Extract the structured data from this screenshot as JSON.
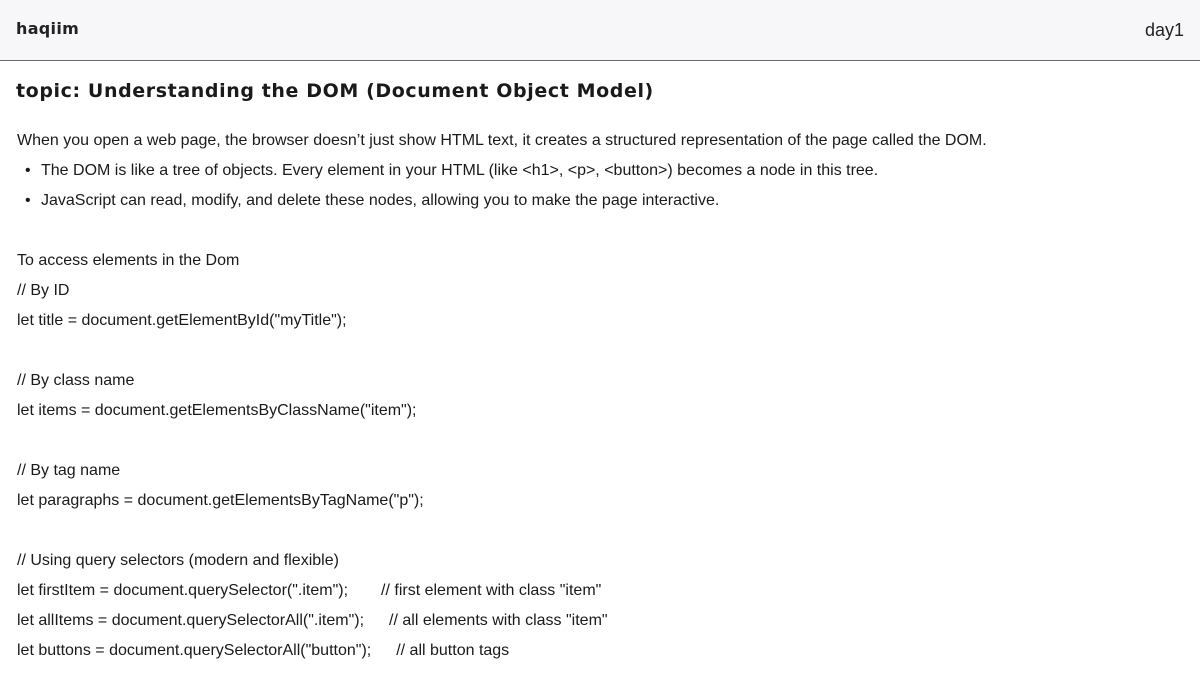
{
  "header": {
    "brand": "haqiim",
    "day": "day1"
  },
  "topic": "topic: Understanding the DOM (Document Object Model)",
  "intro": "When you open a web page, the browser doesn’t just show HTML text, it creates a structured representation of the page called the DOM.",
  "bullets": [
    "The DOM is like a tree of objects. Every element in your HTML (like <h1>, <p>, <button>) becomes a node in this tree.",
    "JavaScript can read, modify, and delete these nodes, allowing you to make the page interactive."
  ],
  "bullet_glyph": "•",
  "access_heading": "To access elements in the Dom",
  "sections": {
    "by_id": {
      "comment": "// By ID",
      "code": "let title = document.getElementById(\"myTitle\");"
    },
    "by_class": {
      "comment": "// By class name",
      "code": "let items = document.getElementsByClassName(\"item\");"
    },
    "by_tag": {
      "comment": "// By tag name",
      "code": "let paragraphs = document.getElementsByTagName(\"p\");"
    },
    "query": {
      "comment": "// Using query selectors (modern and flexible)",
      "lines": [
        {
          "code": "let firstItem = document.querySelector(\".item\");",
          "note": "// first element with class \"item\""
        },
        {
          "code": "let allItems = document.querySelectorAll(\".item\");",
          "note": "// all elements with class \"item\""
        },
        {
          "code": "let buttons = document.querySelectorAll(\"button\");",
          "note": "// all button tags"
        }
      ]
    }
  }
}
